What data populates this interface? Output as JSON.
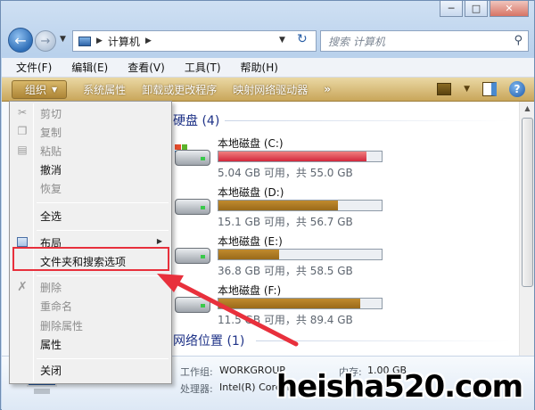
{
  "window": {
    "caption_buttons": [
      "minimize",
      "maximize",
      "close"
    ]
  },
  "address": {
    "breadcrumb": [
      "计算机"
    ],
    "search_placeholder": "搜索 计算机"
  },
  "menubar": {
    "items": [
      "文件(F)",
      "编辑(E)",
      "查看(V)",
      "工具(T)",
      "帮助(H)"
    ]
  },
  "toolbar": {
    "organize": "组织",
    "items": [
      "系统属性",
      "卸载或更改程序",
      "映射网络驱动器"
    ],
    "more": "»"
  },
  "groups": {
    "hard_disks": "硬盘 (4)",
    "network": "网络位置 (1)"
  },
  "drives": [
    {
      "name": "本地磁盘 (C:)",
      "info": "5.04 GB 可用，共 55.0 GB",
      "used_fraction": 0.908,
      "color": "#d2283c"
    },
    {
      "name": "本地磁盘 (D:)",
      "info": "15.1 GB 可用，共 56.7 GB",
      "used_fraction": 0.734,
      "color": "#9a6a1a"
    },
    {
      "name": "本地磁盘 (E:)",
      "info": "36.8 GB 可用，共 58.5 GB",
      "used_fraction": 0.371,
      "color": "#9a6a1a"
    },
    {
      "name": "本地磁盘 (F:)",
      "info": "11.5 GB 可用，共 89.4 GB",
      "used_fraction": 0.871,
      "color": "#9a6a1a"
    }
  ],
  "context_menu": {
    "items": [
      {
        "label": "剪切",
        "disabled": true,
        "icon": "scissors-icon"
      },
      {
        "label": "复制",
        "disabled": true,
        "icon": "copy-icon"
      },
      {
        "label": "粘贴",
        "disabled": true,
        "icon": "paste-icon"
      },
      {
        "label": "撤消",
        "disabled": false
      },
      {
        "label": "恢复",
        "disabled": true
      },
      {
        "label": "全选",
        "disabled": false
      },
      {
        "label": "布局",
        "disabled": false,
        "icon": "layout-icon",
        "submenu": true
      },
      {
        "label": "文件夹和搜索选项",
        "disabled": false
      },
      {
        "label": "删除",
        "disabled": true,
        "icon": "delete-x-icon"
      },
      {
        "label": "重命名",
        "disabled": true
      },
      {
        "label": "删除属性",
        "disabled": true
      },
      {
        "label": "属性",
        "disabled": false
      },
      {
        "label": "关闭",
        "disabled": false
      }
    ]
  },
  "details": {
    "workgroup_label": "工作组:",
    "workgroup_value": "WORKGROUP",
    "memory_label": "内存:",
    "memory_value": "1.00 GB",
    "processor_label": "处理器:",
    "processor_value": "Intel(R) Core(TM) i3-41..."
  },
  "watermark": "heisha520.com",
  "colors": {
    "highlight": "#e8303c",
    "toolbar": "#c9a65a",
    "group_title": "#1e3287"
  }
}
